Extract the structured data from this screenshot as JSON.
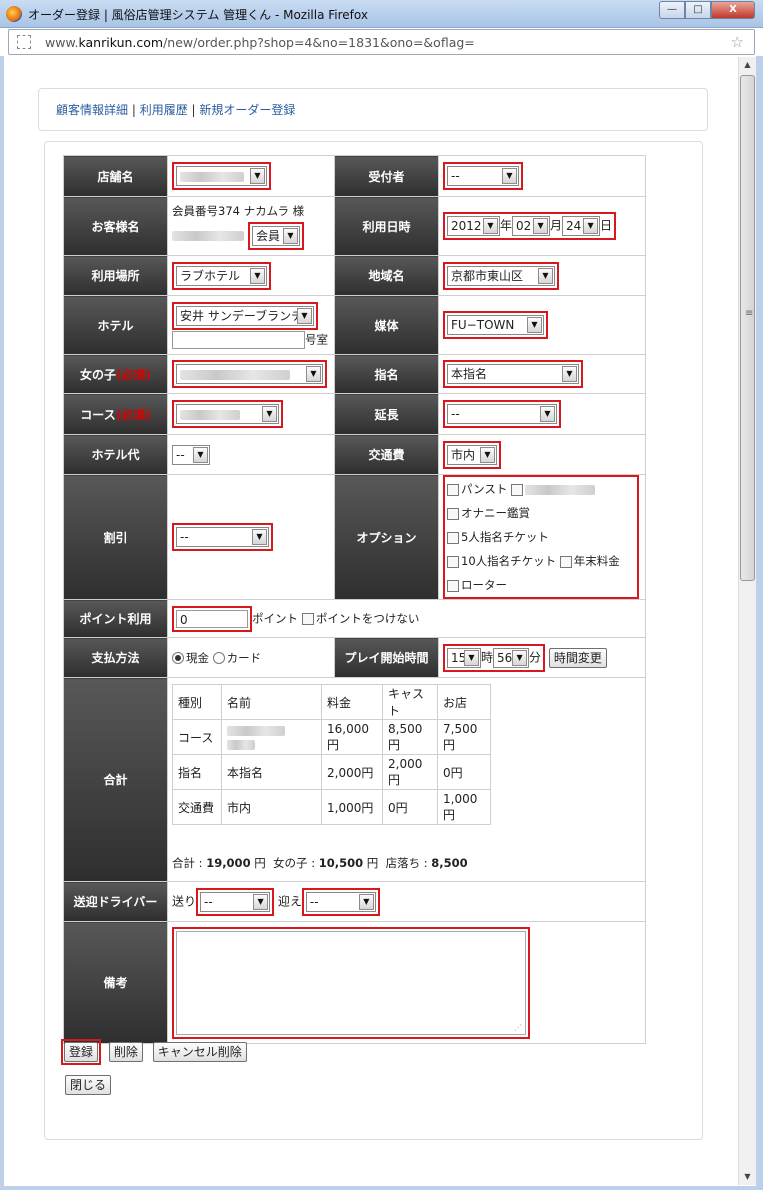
{
  "browser": {
    "title": "オーダー登録 | 風俗店管理システム 管理くん - Mozilla Firefox",
    "url_prefix": "www.",
    "url_domain": "kanrikun.com",
    "url_path": "/new/order.php?shop=4&no=1831&ono=&oflag=",
    "btn_min": "—",
    "btn_max": "□",
    "btn_close": "X"
  },
  "links": {
    "customer": "顧客情報詳細",
    "sep": " | ",
    "history": "利用履歴",
    "new_order": "新規オーダー登録"
  },
  "labels": {
    "shop": "店舗名",
    "receiver": "受付者",
    "customer": "お客様名",
    "use_date": "利用日時",
    "place": "利用場所",
    "area": "地域名",
    "hotel": "ホテル",
    "media": "媒体",
    "girl": "女の子",
    "required": "(必須)",
    "nomination": "指名",
    "course": "コース",
    "extension": "延長",
    "hotel_fee": "ホテル代",
    "transport": "交通費",
    "discount": "割引",
    "options": "オプション",
    "points": "ポイント利用",
    "payment": "支払方法",
    "play_start": "プレイ開始時間",
    "total": "合計",
    "driver": "送迎ドライバー",
    "notes": "備考"
  },
  "values": {
    "receiver": "--",
    "customer_no": "会員番号374 ナカムラ 様",
    "member_sel": "会員",
    "year": "2012",
    "year_u": "年",
    "month": "02",
    "month_u": "月",
    "day": "24",
    "day_u": "日",
    "place": "ラブホテル",
    "area": "京都市東山区",
    "hotel": "安井 サンデーブランチ",
    "room_unit": "号室",
    "media": "FU−TOWN",
    "nomination": "本指名",
    "extension": "--",
    "hotel_fee": "--",
    "transport": "市内",
    "discount": "--",
    "points": "0",
    "points_unit": "ポイント",
    "no_points": "ポイントをつけない",
    "pay_cash": "現金",
    "pay_card": "カード",
    "hour": "15",
    "hour_u": "時",
    "minute": "56",
    "minute_u": "分",
    "time_change": "時間変更",
    "send": "送り",
    "pickup": "迎え",
    "send_val": "--",
    "pickup_val": "--"
  },
  "options": {
    "o1": "パンスト",
    "o3": "オナニー鑑賞",
    "o4": "5人指名チケット",
    "o5": "10人指名チケット",
    "o6": "年末料金",
    "o7": "ローター"
  },
  "summary": {
    "headers": [
      "種別",
      "名前",
      "料金",
      "キャスト",
      "お店"
    ],
    "rows": [
      [
        "コース",
        "",
        "16,000円",
        "8,500円",
        "7,500円"
      ],
      [
        "指名",
        "本指名",
        "2,000円",
        "2,000円",
        "0円"
      ],
      [
        "交通費",
        "市内",
        "1,000円",
        "0円",
        "1,000円"
      ]
    ],
    "total_label": "合計 : ",
    "total_val": "19,000",
    "yen": "円",
    "girl_label": "女の子 : ",
    "girl_val": "10,500",
    "shop_label": "店落ち : ",
    "shop_val": "8,500"
  },
  "buttons": {
    "register": "登録",
    "delete": "削除",
    "cancel_delete": "キャンセル削除",
    "close": "閉じる"
  }
}
